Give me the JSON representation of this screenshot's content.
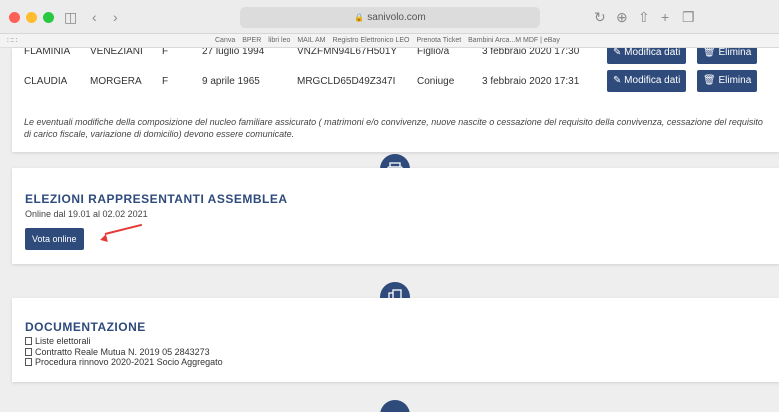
{
  "browser": {
    "url": "sanivolo.com",
    "bookmarks": [
      "Canva",
      "BPER",
      "libri leo",
      "MAIL AM",
      "Registro Elettronico LEO",
      "Prenota Ticket",
      "Bambini Arca...M MDF | eBay"
    ]
  },
  "family": {
    "rows": [
      {
        "name": "FLAMINIA",
        "surname": "VENEZIANI",
        "sex": "F",
        "birth": "27 luglio 1994",
        "cf": "VNZFMN94L67H501Y",
        "relation": "Figlio/a",
        "date": "3 febbraio 2020 17:30",
        "edit_label": "Modifica dati",
        "delete_label": "Elimina"
      },
      {
        "name": "CLAUDIA",
        "surname": "MORGERA",
        "sex": "F",
        "birth": "9 aprile 1965",
        "cf": "MRGCLD65D49Z347I",
        "relation": "Coniuge",
        "date": "3 febbraio 2020 17:31",
        "edit_label": "Modifica dati",
        "delete_label": "Elimina"
      }
    ],
    "notice": "Le eventuali modifiche della composizione del nucleo familiare assicurato ( matrimoni e/o convivenze, nuove nascite o cessazione del requisito della convivenza, cessazione del requisito di carico fiscale, variazione di domicilio) devono essere comunicate."
  },
  "elections": {
    "title": "ELEZIONI RAPPRESENTANTI ASSEMBLEA",
    "subtitle": "Online dal 19.01 al 02.02 2021",
    "vote_label": "Vota online"
  },
  "documents": {
    "title": "DOCUMENTAZIONE",
    "links": [
      "Liste elettorali",
      "Contratto Reale Mutua N. 2019 05 2843273",
      "Procedura rinnovo 2020-2021 Socio Aggregato"
    ]
  },
  "icons": {
    "printer": "printer-icon",
    "copy": "copy-icon",
    "accent": "#2f4b7c",
    "arrow": "#e53935"
  }
}
